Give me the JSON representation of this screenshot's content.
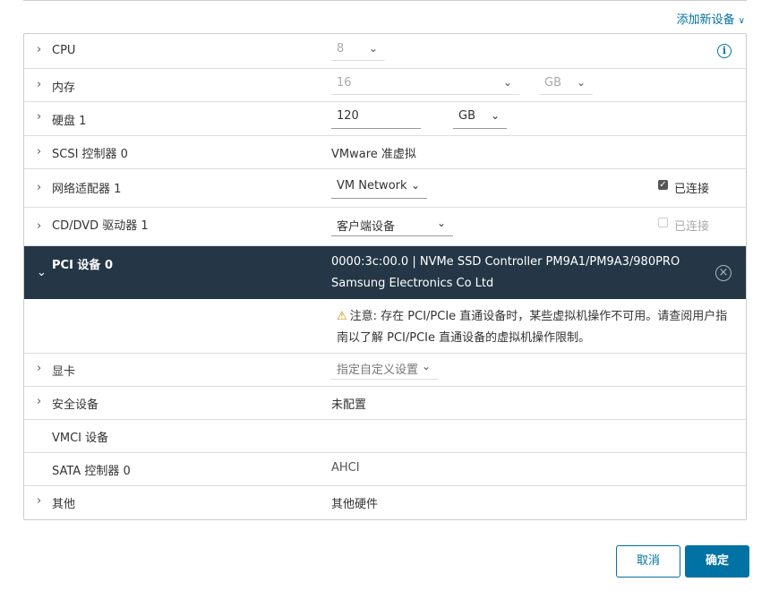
{
  "header": {
    "add_device_label": "添加新设备"
  },
  "rows": {
    "cpu": {
      "label": "CPU",
      "value": "8"
    },
    "memory": {
      "label": "内存",
      "value": "16",
      "unit": "GB"
    },
    "disk": {
      "label": "硬盘 1",
      "value": "120",
      "unit": "GB"
    },
    "scsi": {
      "label": "SCSI 控制器 0",
      "value": "VMware 准虚拟"
    },
    "network": {
      "label": "网络适配器 1",
      "value": "VM Network",
      "connected_label": "已连接"
    },
    "cddvd": {
      "label": "CD/DVD 驱动器 1",
      "value": "客户端设备",
      "connected_label": "已连接"
    },
    "pci": {
      "label": "PCI 设备 0",
      "line1": "0000:3c:00.0 | NVMe SSD Controller PM9A1/PM9A3/980PRO",
      "line2": "Samsung Electronics Co Ltd",
      "warning_line1": "注意: 存在 PCI/PCIe 直通设备时，某些虚拟机操作不可用。请查阅用户指",
      "warning_line2": "南以了解 PCI/PCIe 直通设备的虚拟机操作限制。"
    },
    "video": {
      "label": "显卡",
      "value": "指定自定义设置"
    },
    "security": {
      "label": "安全设备",
      "value": "未配置"
    },
    "vmci": {
      "label": "VMCI 设备"
    },
    "sata": {
      "label": "SATA 控制器 0",
      "value": "AHCI"
    },
    "other": {
      "label": "其他",
      "value": "其他硬件"
    }
  },
  "footer": {
    "cancel_label": "取消",
    "ok_label": "确定"
  },
  "colors": {
    "accent": "#0072a3",
    "selected_row": "#253746",
    "warning": "#c98d00"
  }
}
